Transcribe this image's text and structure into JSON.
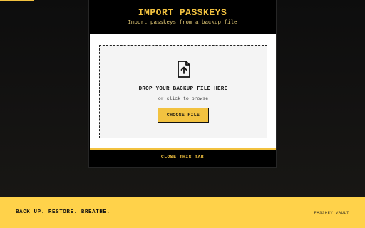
{
  "modal": {
    "title": "IMPORT PASSKEYS",
    "subtitle": "Import passkeys from a backup file"
  },
  "dropzone": {
    "icon": "file-upload-icon",
    "title": "DROP YOUR BACKUP FILE HERE",
    "hint": "or click to browse",
    "button_label": "CHOOSE FILE"
  },
  "close_label": "CLOSE THIS TAB",
  "footer": {
    "tagline": "BACK UP. RESTORE. BREATHE.",
    "brand": "PASSKEY VAULT"
  },
  "colors": {
    "accent": "#f2c240",
    "footer_bg": "#ffd24a",
    "page_bg": "#111111"
  }
}
